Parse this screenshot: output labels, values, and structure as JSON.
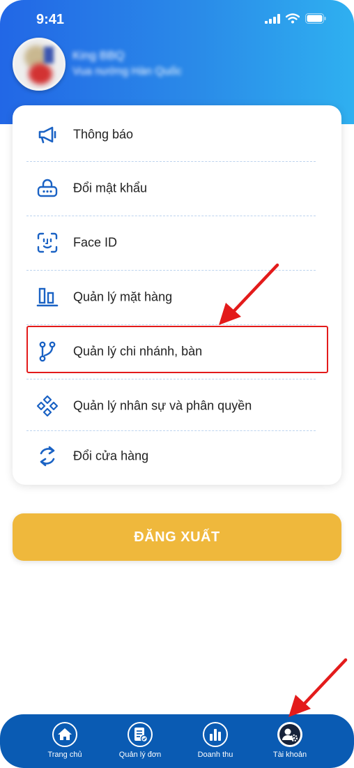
{
  "status": {
    "time": "9:41"
  },
  "profile": {
    "name": "King BBQ",
    "store": "Vua nướng Hàn Quốc"
  },
  "menu": [
    {
      "label": "Thông báo",
      "icon": "megaphone-icon"
    },
    {
      "label": "Đổi mật khẩu",
      "icon": "lock-icon"
    },
    {
      "label": "Face ID",
      "icon": "face-id-icon"
    },
    {
      "label": "Quản lý mặt hàng",
      "icon": "bar-chart-icon"
    },
    {
      "label": "Quản lý chi nhánh, bàn",
      "icon": "branch-icon"
    },
    {
      "label": "Quản lý nhân sự và phân quyền",
      "icon": "diamond-grid-icon"
    },
    {
      "label": "Đổi cửa hàng",
      "icon": "refresh-icon"
    }
  ],
  "logout_label": "ĐĂNG XUẤT",
  "bottom_nav": [
    {
      "label": "Trang chủ",
      "icon": "home-icon"
    },
    {
      "label": "Quản lý đơn",
      "icon": "orders-icon"
    },
    {
      "label": "Doanh thu",
      "icon": "revenue-icon"
    },
    {
      "label": "Tài khoản",
      "icon": "account-icon"
    }
  ],
  "colors": {
    "header_start": "#2267e6",
    "header_end": "#2fb0f0",
    "icon_blue": "#1a62c4",
    "logout": "#efb83c",
    "nav_bg": "#0a5bb3",
    "highlight": "#e31b1b"
  }
}
